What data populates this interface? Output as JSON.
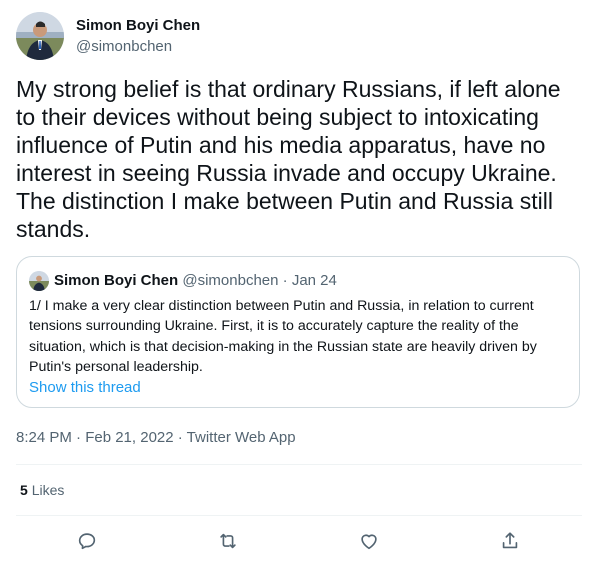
{
  "author": {
    "name": "Simon Boyi Chen",
    "handle": "@simonbchen"
  },
  "tweet": {
    "text": "My strong belief is that ordinary Russians, if left alone\nto their devices without being subject to intoxicating\ninfluence of Putin and his media apparatus, have no\ninterest in seeing Russia invade and occupy Ukraine.\nThe distinction I make between Putin and Russia still\nstands."
  },
  "quoted_tweet": {
    "name": "Simon Boyi Chen",
    "handle": "@simonbchen",
    "separator": "·",
    "date": "Jan 24",
    "text": "1/ I make a very clear distinction between Putin and Russia, in relation to current\ntensions surrounding Ukraine. First, it is to accurately capture the reality of the\nsituation, which is that decision-making in the Russian state are heavily driven by\nPutin's personal leadership.",
    "show_thread": "Show this thread"
  },
  "meta": {
    "timestamp": "8:24 PM · Feb 21, 2022 · Twitter Web App"
  },
  "stats": {
    "likes_count": "5",
    "likes_label": "Likes"
  },
  "actions": {
    "reply_icon": "reply-icon",
    "retweet_icon": "retweet-icon",
    "like_icon": "heart-icon",
    "share_icon": "share-icon"
  },
  "colors": {
    "text": "#0f1419",
    "secondary": "#536471",
    "link": "#1d9bf0",
    "border": "#cfd9de",
    "divider": "#eff3f4"
  }
}
